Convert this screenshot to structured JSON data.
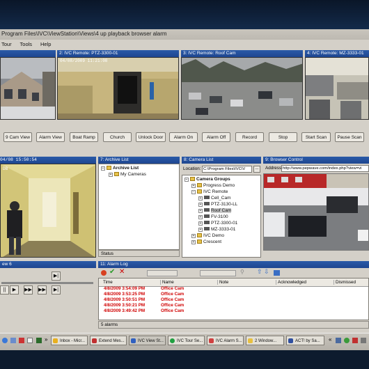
{
  "window": {
    "title": "Program Files\\IVC\\ViewStation\\Views\\4 up playback browser alarm"
  },
  "menu": [
    "Tour",
    "Tools",
    "Help"
  ],
  "cameras": {
    "c2": {
      "header": "2: IVC Remote: PTZ-3300-01",
      "timestamp": "04/08/2009 11:21:08"
    },
    "c3": {
      "header": "3: IVC Remote: Roof Cam"
    },
    "c4": {
      "header": "4: IVC Remote: MZ-3333-01"
    },
    "c5": {
      "timestamp": "04/08 15:50:54",
      "label": "DB"
    },
    "c6": {
      "header": "ew 6"
    }
  },
  "buttons": [
    "9 Cam View",
    "Alarm View",
    "Boat Ramp",
    "Church",
    "Unlock Door",
    "Alarm On",
    "Alarm Off",
    "Record",
    "Stop",
    "Start Scan",
    "Pause Scan"
  ],
  "archive": {
    "header": "7: Archive List",
    "root": "Archive List",
    "child": "My Cameras",
    "status": "Status"
  },
  "camlist": {
    "header": "8: Camera List",
    "location_label": "Location:",
    "location_value": "C:\\Program Files\\IVC\\V",
    "root": "Camera Groups",
    "groups": [
      "Progress Demo",
      "IVC Remote",
      "IVC Demo",
      "Crescent"
    ],
    "cams": [
      "Cell_Cam",
      "PTZ-3130-LL",
      "Roof Cam",
      "FV-3100",
      "PTZ-3300-01",
      "MZ-3333-01"
    ]
  },
  "browser": {
    "header": "9: Browser Control",
    "address_label": "Address",
    "url": "http://www.pepwave.com/index.php?view=vi"
  },
  "alarmlog": {
    "header": "11: Alarm Log",
    "columns": [
      "Time",
      "Name",
      "Note",
      "Acknowledged",
      "Dismissed"
    ],
    "rows": [
      {
        "time": "4/8/2009 3:54:09 PM",
        "name": "Office Cam"
      },
      {
        "time": "4/8/2009 3:53:25 PM",
        "name": "Office Cam"
      },
      {
        "time": "4/8/2009 3:50:51 PM",
        "name": "Office Cam"
      },
      {
        "time": "4/8/2009 3:50:21 PM",
        "name": "Office Cam"
      },
      {
        "time": "4/8/2009 3:49:42 PM",
        "name": "Office Cam"
      }
    ],
    "status": "5 alarms"
  },
  "taskbar": [
    {
      "label": "Inbox - Micr...",
      "color": "#e8b020"
    },
    {
      "label": "Extend Mes...",
      "color": "#c03030"
    },
    {
      "label": "IVC View St...",
      "color": "#3060c0"
    },
    {
      "label": "IVC Tour Se...",
      "color": "#20a040"
    },
    {
      "label": "IVC Alarm S...",
      "color": "#d04040"
    },
    {
      "label": "2 Window...",
      "color": "#e8c040"
    },
    {
      "label": "ACT! by Sa...",
      "color": "#3050a0"
    }
  ]
}
